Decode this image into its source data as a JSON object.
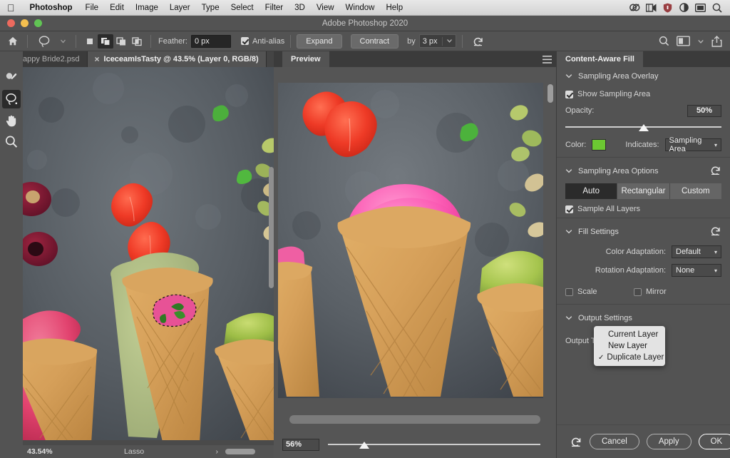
{
  "macmenu": {
    "apple": "apple-logo",
    "items": [
      "Photoshop",
      "File",
      "Edit",
      "Image",
      "Layer",
      "Type",
      "Select",
      "Filter",
      "3D",
      "View",
      "Window",
      "Help"
    ],
    "tray": [
      "creative-cloud-icon",
      "display-capture-icon",
      "shield-icon",
      "contrast-icon",
      "screen-icon",
      "spotlight-search-icon"
    ]
  },
  "window": {
    "title": "Adobe Photoshop 2020"
  },
  "options_bar": {
    "home_icon": "home-icon",
    "tool_icon": "lasso-tool-icon",
    "selection_modes": [
      "new-selection-icon",
      "add-to-selection-icon",
      "subtract-from-selection-icon",
      "intersect-selection-icon"
    ],
    "active_selection_mode": 1,
    "feather_label": "Feather:",
    "feather_value": "0 px",
    "antialias_label": "Anti-alias",
    "antialias_checked": true,
    "expand_label": "Expand",
    "contract_label": "Contract",
    "by_label": "by",
    "by_value": "3 px",
    "reset_icon": "reset-icon",
    "search_icon": "search-icon",
    "workspace_icon": "workspace-icon",
    "workspace_caret": "chevron-down-icon",
    "share_icon": "share-icon"
  },
  "tabs": {
    "expand_icon": "expand-panel-icon",
    "items": [
      {
        "label": "appy Bride2.psd",
        "active": false,
        "closable": false
      },
      {
        "label": "IceceamIsTasty @ 43.5% (Layer 0, RGB/8)",
        "active": true,
        "closable": true,
        "close_icon": "close-icon"
      }
    ],
    "more_icon": "more-tabs-icon"
  },
  "toolbar": {
    "tools": [
      {
        "name": "spot-healing-brush-tool",
        "active": false
      },
      {
        "name": "lasso-tool",
        "active": true
      },
      {
        "name": "hand-tool",
        "active": false
      },
      {
        "name": "zoom-tool",
        "active": false
      }
    ]
  },
  "document": {
    "status_zoom": "43.54%",
    "status_tool": "Lasso",
    "status_arrow": "›"
  },
  "preview": {
    "tab_label": "Preview",
    "menu_icon": "panel-menu-icon",
    "zoom_value": "56%",
    "zoom_slider_pct": 17
  },
  "caf": {
    "tab_label": "Content-Aware Fill",
    "sampling_overlay": {
      "title": "Sampling Area Overlay",
      "chevron": "chevron-down-icon",
      "show_label": "Show Sampling Area",
      "show_checked": true,
      "opacity_label": "Opacity:",
      "opacity_value": "50%",
      "opacity_pct": 50,
      "color_label": "Color:",
      "color_value": "#6cc832",
      "indicates_label": "Indicates:",
      "indicates_value": "Sampling Area",
      "indicates_caret": "chevron-down-icon"
    },
    "sampling_options": {
      "title": "Sampling Area Options",
      "chevron": "chevron-down-icon",
      "reset_icon": "reset-icon",
      "segments": [
        "Auto",
        "Rectangular",
        "Custom"
      ],
      "active_segment": 0,
      "sample_all_label": "Sample All Layers",
      "sample_all_checked": true
    },
    "fill_settings": {
      "title": "Fill Settings",
      "chevron": "chevron-down-icon",
      "reset_icon": "reset-icon",
      "color_adaptation_label": "Color Adaptation:",
      "color_adaptation_value": "Default",
      "rotation_adaptation_label": "Rotation Adaptation:",
      "rotation_adaptation_value": "None",
      "scale_label": "Scale",
      "scale_checked": false,
      "mirror_label": "Mirror",
      "mirror_checked": false
    },
    "output_settings": {
      "title": "Output Settings",
      "chevron": "chevron-down-icon",
      "output_to_label": "Output To:"
    },
    "output_menu": {
      "items": [
        {
          "label": "Current Layer",
          "checked": false
        },
        {
          "label": "New Layer",
          "checked": false
        },
        {
          "label": "Duplicate Layer",
          "checked": true
        }
      ],
      "check_glyph": "✓"
    },
    "footer": {
      "reset_icon": "reset-icon",
      "cancel_label": "Cancel",
      "apply_label": "Apply",
      "ok_label": "OK"
    }
  }
}
